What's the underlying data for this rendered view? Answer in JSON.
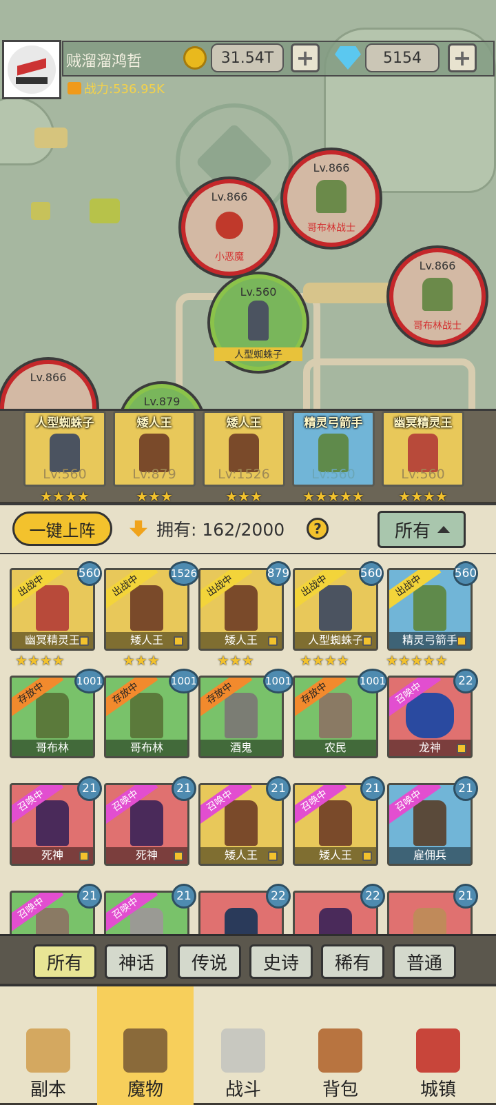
{
  "player": {
    "name": "贼溜溜鸿哲",
    "power": "战力:536.95K",
    "gold": "31.54T",
    "gems": "5154"
  },
  "map_units": [
    {
      "level": "Lv.866",
      "name": "小恶魔"
    },
    {
      "level": "Lv.866",
      "name": "哥布林战士"
    },
    {
      "level": "Lv.866",
      "name": "哥布林战士"
    },
    {
      "level": "Lv.560",
      "name": "人型蜘蛛子"
    },
    {
      "level": "Lv.866",
      "name": ""
    },
    {
      "level": "Lv.879",
      "name": ""
    }
  ],
  "team": [
    {
      "name": "人型蜘蛛子",
      "level": "Lv:560",
      "stars": "★★★★"
    },
    {
      "name": "矮人王",
      "level": "Lv:879",
      "stars": "★★★"
    },
    {
      "name": "矮人王",
      "level": "Lv:1526",
      "stars": "★★★"
    },
    {
      "name": "精灵弓箭手",
      "level": "Lv:560",
      "stars": "★★★★★"
    },
    {
      "name": "幽冥精灵王",
      "level": "Lv:560",
      "stars": "★★★★"
    }
  ],
  "controls": {
    "deploy": "一键上阵",
    "own_label": "拥有:",
    "own_count": "162/2000",
    "help": "?",
    "filter": "所有"
  },
  "monsters": [
    {
      "name": "幽冥精灵王",
      "level": "560",
      "tag": "出战中",
      "stars": "★★★★"
    },
    {
      "name": "矮人王",
      "level": "1526",
      "tag": "出战中",
      "stars": "★★★"
    },
    {
      "name": "矮人王",
      "level": "879",
      "tag": "出战中",
      "stars": "★★★"
    },
    {
      "name": "人型蜘蛛子",
      "level": "560",
      "tag": "出战中",
      "stars": "★★★★"
    },
    {
      "name": "精灵弓箭手",
      "level": "560",
      "tag": "出战中",
      "stars": "★★★★★"
    },
    {
      "name": "哥布林",
      "level": "1001",
      "tag": "存放中"
    },
    {
      "name": "哥布林",
      "level": "1001",
      "tag": "存放中"
    },
    {
      "name": "酒鬼",
      "level": "1001",
      "tag": "存放中"
    },
    {
      "name": "农民",
      "level": "1001",
      "tag": "存放中"
    },
    {
      "name": "龙神",
      "level": "22",
      "tag": "召唤中"
    },
    {
      "name": "死神",
      "level": "21",
      "tag": "召唤中"
    },
    {
      "name": "死神",
      "level": "21",
      "tag": "召唤中"
    },
    {
      "name": "矮人王",
      "level": "21",
      "tag": "召唤中"
    },
    {
      "name": "矮人王",
      "level": "21",
      "tag": "召唤中"
    },
    {
      "name": "雇佣兵",
      "level": "21",
      "tag": "召唤中"
    },
    {
      "name": "",
      "level": "21",
      "tag": "召唤中"
    },
    {
      "name": "",
      "level": "21",
      "tag": "召唤中"
    },
    {
      "name": "",
      "level": "22",
      "tag": ""
    },
    {
      "name": "",
      "level": "22",
      "tag": ""
    },
    {
      "name": "",
      "level": "21",
      "tag": ""
    }
  ],
  "rarity_tabs": [
    "所有",
    "神话",
    "传说",
    "史诗",
    "稀有",
    "普通"
  ],
  "nav": [
    "副本",
    "魔物",
    "战斗",
    "背包",
    "城镇"
  ]
}
